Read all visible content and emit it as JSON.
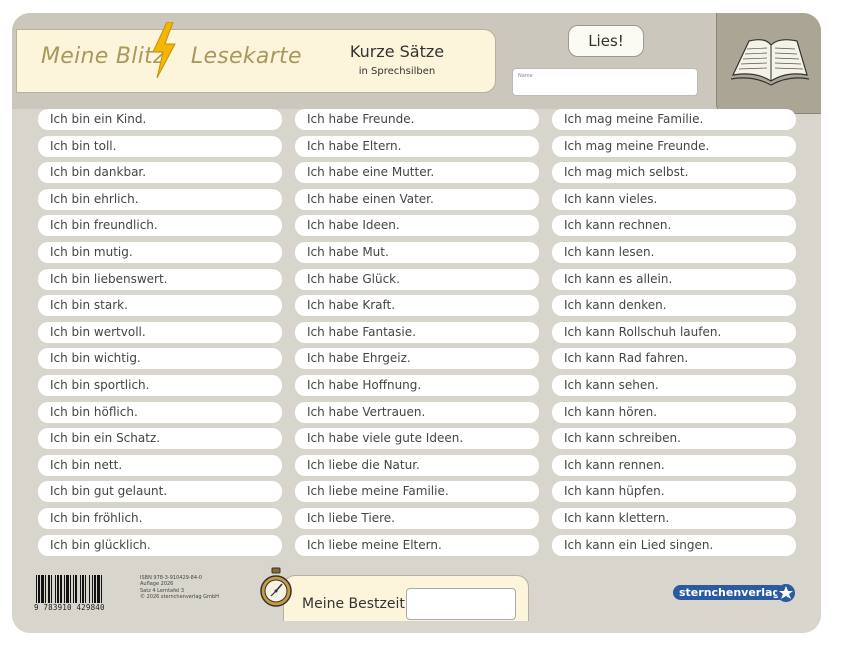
{
  "header": {
    "logo_word1": "Meine Blitz",
    "logo_word2": "Lesekarte",
    "subtitle": "Kurze Sätze",
    "subtitle_sub": "in Sprechsilben",
    "lies_label": "Lies!",
    "name_label": "Name"
  },
  "columns": [
    [
      "Ich bin ein Kind.",
      "Ich bin toll.",
      "Ich bin dankbar.",
      "Ich bin ehrlich.",
      "Ich bin freundlich.",
      "Ich bin mutig.",
      "Ich bin liebenswert.",
      "Ich bin stark.",
      "Ich bin wertvoll.",
      "Ich bin wichtig.",
      "Ich bin sportlich.",
      "Ich bin höflich.",
      "Ich bin ein Schatz.",
      "Ich bin nett.",
      "Ich bin gut gelaunt.",
      "Ich bin fröhlich.",
      "Ich bin glücklich."
    ],
    [
      "Ich habe Freunde.",
      "Ich habe Eltern.",
      "Ich habe eine Mutter.",
      "Ich habe einen Vater.",
      "Ich habe Ideen.",
      "Ich habe Mut.",
      "Ich habe Glück.",
      "Ich habe Kraft.",
      "Ich habe Fantasie.",
      "Ich habe Ehrgeiz.",
      "Ich habe Hoffnung.",
      "Ich habe Vertrauen.",
      "Ich habe viele gute Ideen.",
      "Ich liebe die Natur.",
      "Ich liebe meine Familie.",
      "Ich liebe Tiere.",
      "Ich liebe meine Eltern."
    ],
    [
      "Ich mag meine Familie.",
      "Ich mag meine Freunde.",
      "Ich mag mich selbst.",
      "Ich kann vieles.",
      "Ich kann rechnen.",
      "Ich kann lesen.",
      "Ich kann es allein.",
      "Ich kann denken.",
      "Ich kann Rollschuh laufen.",
      "Ich kann Rad fahren.",
      "Ich kann sehen.",
      "Ich kann hören.",
      "Ich kann schreiben.",
      "Ich kann rennen.",
      "Ich kann hüpfen.",
      "Ich kann klettern.",
      "Ich kann ein Lied singen."
    ]
  ],
  "footer": {
    "barcode_number": "9 783910 429840",
    "isbn_lines": [
      "ISBN 978-3-910429-84-0",
      "Auflage 2026",
      "Satz 4  Lerntafel 3",
      "© 2026 sternchenverlag GmbH"
    ],
    "timer_label": "Meine Bestzeit",
    "publisher": "sternchenverlag"
  },
  "colors": {
    "background": "#d8d5cc",
    "title_panel": "#fdf4dc",
    "logo_text": "#a89a5c",
    "bolt": "#f2b705",
    "publisher_badge": "#2a5aa0"
  },
  "icons": [
    "lightning-bolt-icon",
    "open-book-icon",
    "stopwatch-icon",
    "barcode-icon",
    "star-icon"
  ]
}
